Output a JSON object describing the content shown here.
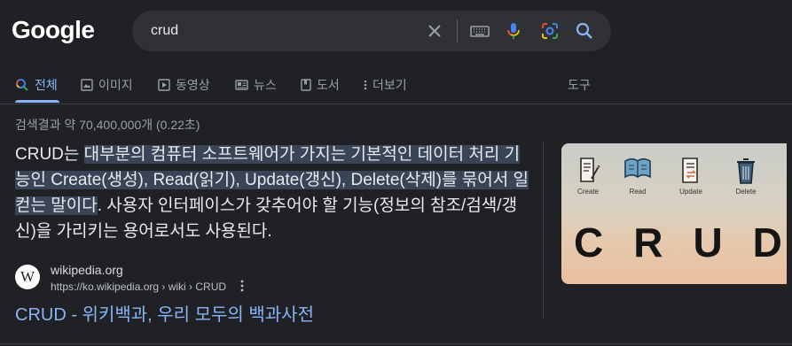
{
  "logo": "Google",
  "search": {
    "query": "crud"
  },
  "tabs": [
    {
      "label": "전체",
      "active": true
    },
    {
      "label": "이미지"
    },
    {
      "label": "동영상"
    },
    {
      "label": "뉴스"
    },
    {
      "label": "도서"
    },
    {
      "label": "더보기"
    },
    {
      "label": "도구"
    }
  ],
  "stats": "검색결과 약 70,400,000개 (0.22초)",
  "snippet": {
    "lead": "CRUD는 ",
    "highlight": "대부분의 컴퓨터 소프트웨어가 가지는 기본적인 데이터 처리 기능인 Create(생성), Read(읽기), Update(갱신), Delete(삭제)를 묶어서 일컫는 말이다",
    "rest": ". 사용자 인터페이스가 갖추어야 할 기능(정보의 참조/검색/갱신)을 가리키는 용어로서도 사용된다."
  },
  "source": {
    "favicon_letter": "W",
    "name": "wikipedia.org",
    "url": "https://ko.wikipedia.org › wiki › CRUD"
  },
  "result_title": "CRUD - 위키백과, 우리 모두의 백과사전",
  "thumbnail": {
    "labels": [
      "Create",
      "Read",
      "Update",
      "Delete"
    ],
    "big_text": "CRUD"
  },
  "colors": {
    "background": "#202124",
    "link": "#8ab4f8",
    "highlight": "#394457"
  },
  "icons": [
    "clear-icon",
    "keyboard-icon",
    "mic-icon",
    "lens-icon",
    "search-icon",
    "images-tab-icon",
    "videos-tab-icon",
    "news-tab-icon",
    "books-tab-icon",
    "more-dots-icon"
  ]
}
